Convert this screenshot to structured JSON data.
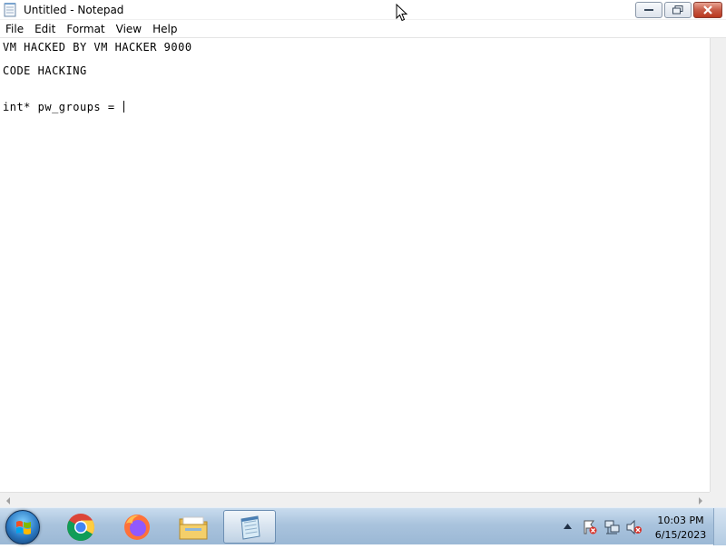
{
  "window": {
    "title": "Untitled - Notepad",
    "controls": {
      "minimize": "minimize-icon",
      "maximize": "maximize-icon",
      "close": "close-icon"
    }
  },
  "menu": {
    "items": [
      "File",
      "Edit",
      "Format",
      "View",
      "Help"
    ]
  },
  "editor": {
    "lines": [
      "VM HACKED BY VM HACKER 9000",
      "CODE HACKING",
      "int* pw_groups = "
    ]
  },
  "taskbar": {
    "pinned": [
      "windows-start-icon",
      "chrome-icon",
      "firefox-icon",
      "file-explorer-icon",
      "notepad-icon"
    ],
    "active": "notepad-icon",
    "tray_icons": [
      "show-hidden-icons-arrow",
      "action-center-icon",
      "network-icon",
      "volume-muted-icon"
    ],
    "time": "10:03 PM",
    "date": "6/15/2023"
  },
  "colors": {
    "taskbar_top": "#c9dcee",
    "taskbar_bottom": "#9bb8d5",
    "close_button": "#c75b47"
  }
}
